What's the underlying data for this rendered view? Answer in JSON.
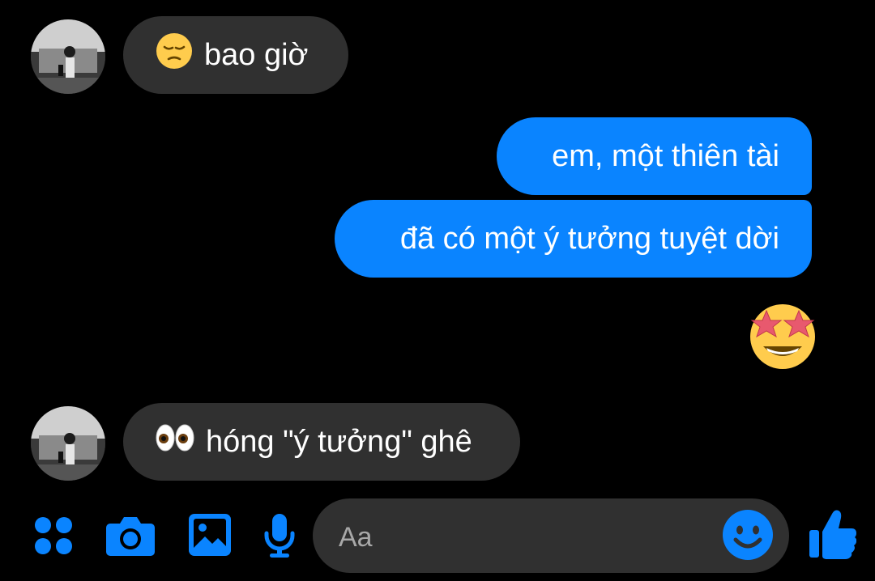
{
  "messages": [
    {
      "direction": "in",
      "text": "bao giờ",
      "emoji": "pensive-face"
    },
    {
      "direction": "out",
      "text": "em, một thiên tài"
    },
    {
      "direction": "out",
      "text": "đã có một ý tưởng tuyệt dời"
    },
    {
      "direction": "out",
      "emoji_only": "star-struck-face"
    },
    {
      "direction": "in",
      "text": "hóng \"ý tưởng\" ghê",
      "emoji": "eyes"
    }
  ],
  "composer": {
    "placeholder": "Aa"
  },
  "toolbar": {
    "icons": [
      "apps-icon",
      "camera-icon",
      "gallery-icon",
      "microphone-icon",
      "emoji-icon",
      "thumbs-up-icon"
    ]
  },
  "colors": {
    "background": "#000000",
    "incoming_bubble": "#303030",
    "outgoing_bubble": "#0a84ff",
    "accent": "#0a84ff"
  }
}
